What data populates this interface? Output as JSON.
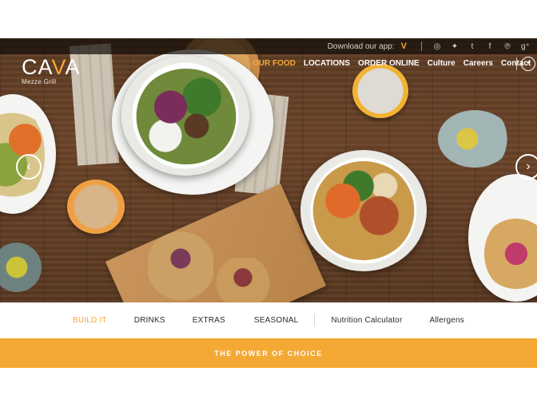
{
  "utility": {
    "app_text": "Download our app:",
    "app_logo": "V",
    "social_icons": [
      "instagram-icon",
      "twitter-icon",
      "tumblr-icon",
      "facebook-icon",
      "pinterest-icon",
      "google-plus-icon"
    ],
    "social_glyphs": [
      "◎",
      "✦",
      "t",
      "f",
      "℗",
      "g⁺"
    ]
  },
  "logo": {
    "brand_prefix": "CA",
    "brand_accent": "V",
    "brand_suffix": "A",
    "tagline": "Mezze Grill"
  },
  "nav": {
    "items": [
      {
        "label": "OUR FOOD",
        "active": true
      },
      {
        "label": "LOCATIONS",
        "active": false
      },
      {
        "label": "ORDER ONLINE",
        "active": false
      },
      {
        "label": "Culture",
        "active": false
      },
      {
        "label": "Careers",
        "active": false
      },
      {
        "label": "Contact",
        "active": false
      }
    ],
    "more_glyph": "•••"
  },
  "carousel": {
    "prev_glyph": "‹",
    "next_glyph": "›"
  },
  "subnav": {
    "items": [
      "BUILD IT",
      "DRINKS",
      "EXTRAS",
      "SEASONAL"
    ],
    "secondary": [
      "Nutrition Calculator",
      "Allergens"
    ]
  },
  "banner": {
    "text": "THE POWER OF CHOICE"
  },
  "colors": {
    "accent": "#f4a934",
    "nav_text": "#ffffff",
    "subnav_text": "#2b2b2b"
  }
}
